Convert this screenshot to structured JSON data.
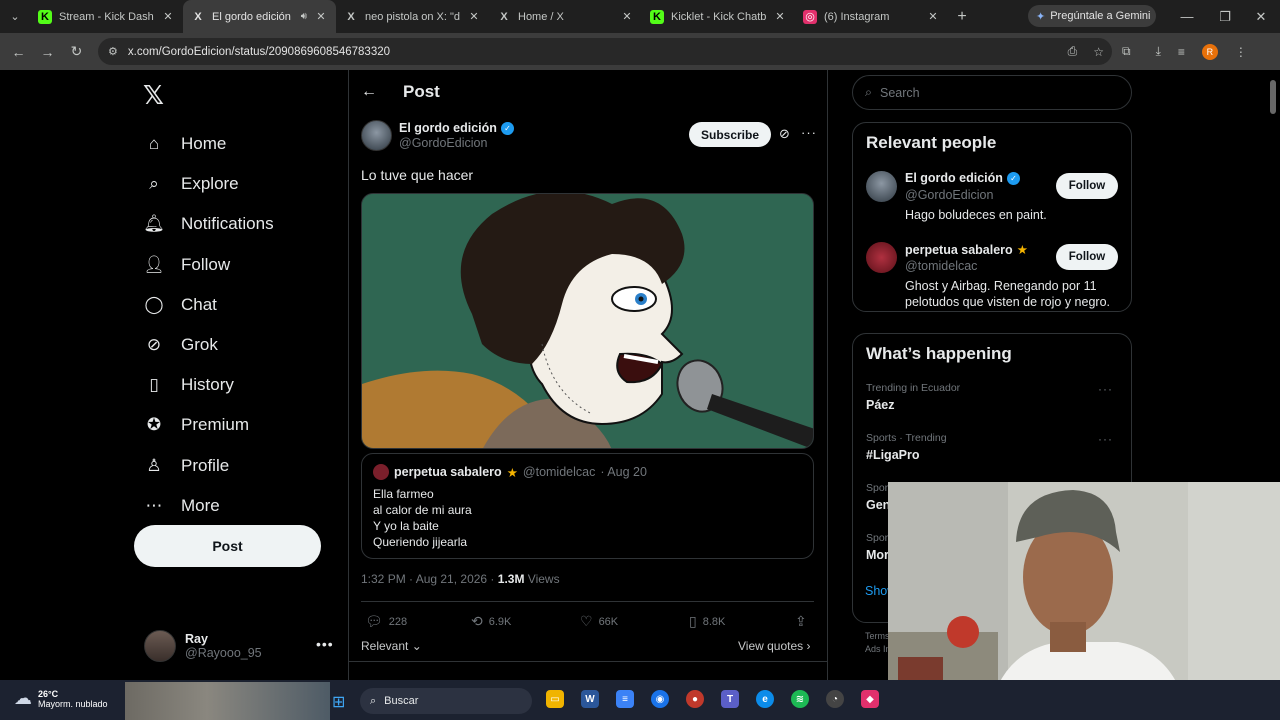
{
  "browser": {
    "tabs": [
      {
        "title": "Stream - Kick Dashboard",
        "favicon": "K",
        "fav_color": "#53fc18",
        "active": false
      },
      {
        "title": "El gordo edición on X",
        "favicon": "X",
        "fav_color": "#ffffff",
        "active": true,
        "audio": true
      },
      {
        "title": "neo pistola on X: \"dios",
        "favicon": "X",
        "fav_color": "#ffffff",
        "active": false
      },
      {
        "title": "Home / X",
        "favicon": "X",
        "fav_color": "#ffffff",
        "active": false
      },
      {
        "title": "Kicklet - Kick Chatbot",
        "favicon": "K",
        "fav_color": "#53fc18",
        "active": false
      },
      {
        "title": "(6) Instagram",
        "favicon": "◎",
        "fav_color": "#e1306c",
        "active": false
      }
    ],
    "gemini_label": "Pregúntale a Gemini",
    "url": "x.com/GordoEdicion/status/2090869608546783320",
    "profile_initial": "R"
  },
  "x": {
    "nav": [
      {
        "label": "Home",
        "icon": "home-icon",
        "glyph": "⌂"
      },
      {
        "label": "Explore",
        "icon": "search-icon",
        "glyph": "⌕"
      },
      {
        "label": "Notifications",
        "icon": "bell-icon",
        "glyph": "🔔︎"
      },
      {
        "label": "Follow",
        "icon": "person-plus-icon",
        "glyph": "👤︎"
      },
      {
        "label": "Chat",
        "icon": "chat-icon",
        "glyph": "◯"
      },
      {
        "label": "Grok",
        "icon": "grok-icon",
        "glyph": "⊘"
      },
      {
        "label": "History",
        "icon": "bookmark-icon",
        "glyph": "▯"
      },
      {
        "label": "Premium",
        "icon": "premium-icon",
        "glyph": "✪"
      },
      {
        "label": "Profile",
        "icon": "profile-icon",
        "glyph": "♙"
      },
      {
        "label": "More",
        "icon": "more-circle-icon",
        "glyph": "⋯"
      }
    ],
    "post_button": "Post",
    "me": {
      "name": "Ray",
      "handle": "@Rayooo_95"
    },
    "header_title": "Post",
    "post": {
      "author_name": "El gordo edición",
      "author_handle": "@GordoEdicion",
      "subscribe_label": "Subscribe",
      "text": "Lo tuve que hacer",
      "quote": {
        "name": "perpetua sabalero",
        "handle": "@tomidelcac",
        "date": "· Aug 20",
        "lines": [
          "Ella farmeo",
          "al calor de mi aura",
          "Y yo la baite",
          "Queriendo jijearla"
        ]
      },
      "timestamp": "1:32 PM · Aug 21, 2026 · ",
      "views_count": "1.3M",
      "views_label": " Views",
      "replies": "228",
      "reposts": "6.9K",
      "likes": "66K",
      "bookmarks": "8.8K",
      "relevant_label": "Relevant",
      "view_quotes": "View quotes"
    },
    "search_placeholder": "Search",
    "relevant_people_title": "Relevant people",
    "people": [
      {
        "name": "El gordo edición",
        "handle": "@GordoEdicion",
        "bio": "Hago boludeces en paint.",
        "follow": "Follow",
        "verified": true
      },
      {
        "name": "perpetua sabalero",
        "handle": "@tomidelcac",
        "bio": "Ghost y Airbag. Renegando por 11 pelotudos que visten de rojo y negro.",
        "follow": "Follow",
        "star": true
      }
    ],
    "happening_title": "What’s happening",
    "trends": [
      {
        "category": "Trending in Ecuador",
        "name": "Páez"
      },
      {
        "category": "Sports · Trending",
        "name": "#LigaPro"
      },
      {
        "category": "Spor",
        "name": "Gen"
      },
      {
        "category": "Spor",
        "name": "Mor"
      }
    ],
    "show_more": "Show",
    "terms": [
      "Terms",
      "Ads In"
    ]
  },
  "taskbar": {
    "temp": "26°C",
    "weather": "Mayorm. nublado",
    "search_placeholder": "Buscar"
  }
}
